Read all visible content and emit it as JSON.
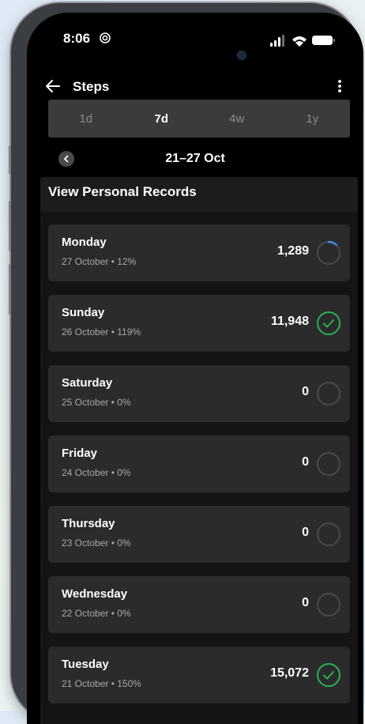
{
  "status_bar": {
    "time": "8:06"
  },
  "app_bar": {
    "title": "Steps"
  },
  "range_tabs": [
    {
      "label": "1d",
      "active": false
    },
    {
      "label": "7d",
      "active": true
    },
    {
      "label": "4w",
      "active": false
    },
    {
      "label": "1y",
      "active": false
    }
  ],
  "date_range": "21–27 Oct",
  "records_link": "View Personal Records",
  "days": [
    {
      "name": "Monday",
      "subtitle": "27 October • 12%",
      "steps": "1,289",
      "progress": 0.12,
      "goal_met": false
    },
    {
      "name": "Sunday",
      "subtitle": "26 October • 119%",
      "steps": "11,948",
      "progress": 1.19,
      "goal_met": true
    },
    {
      "name": "Saturday",
      "subtitle": "25 October • 0%",
      "steps": "0",
      "progress": 0,
      "goal_met": false
    },
    {
      "name": "Friday",
      "subtitle": "24 October • 0%",
      "steps": "0",
      "progress": 0,
      "goal_met": false
    },
    {
      "name": "Thursday",
      "subtitle": "23 October • 0%",
      "steps": "0",
      "progress": 0,
      "goal_met": false
    },
    {
      "name": "Wednesday",
      "subtitle": "22 October • 0%",
      "steps": "0",
      "progress": 0,
      "goal_met": false
    },
    {
      "name": "Tuesday",
      "subtitle": "21 October • 150%",
      "steps": "15,072",
      "progress": 1.5,
      "goal_met": true
    }
  ],
  "colors": {
    "progress_accent": "#3d8eea",
    "goal_met": "#2bb24c",
    "ring_track": "#4a4a4d"
  },
  "icons": {
    "back": "arrow-left-icon",
    "more": "more-vert-icon",
    "prev": "chevron-left-icon",
    "check": "check-icon"
  }
}
